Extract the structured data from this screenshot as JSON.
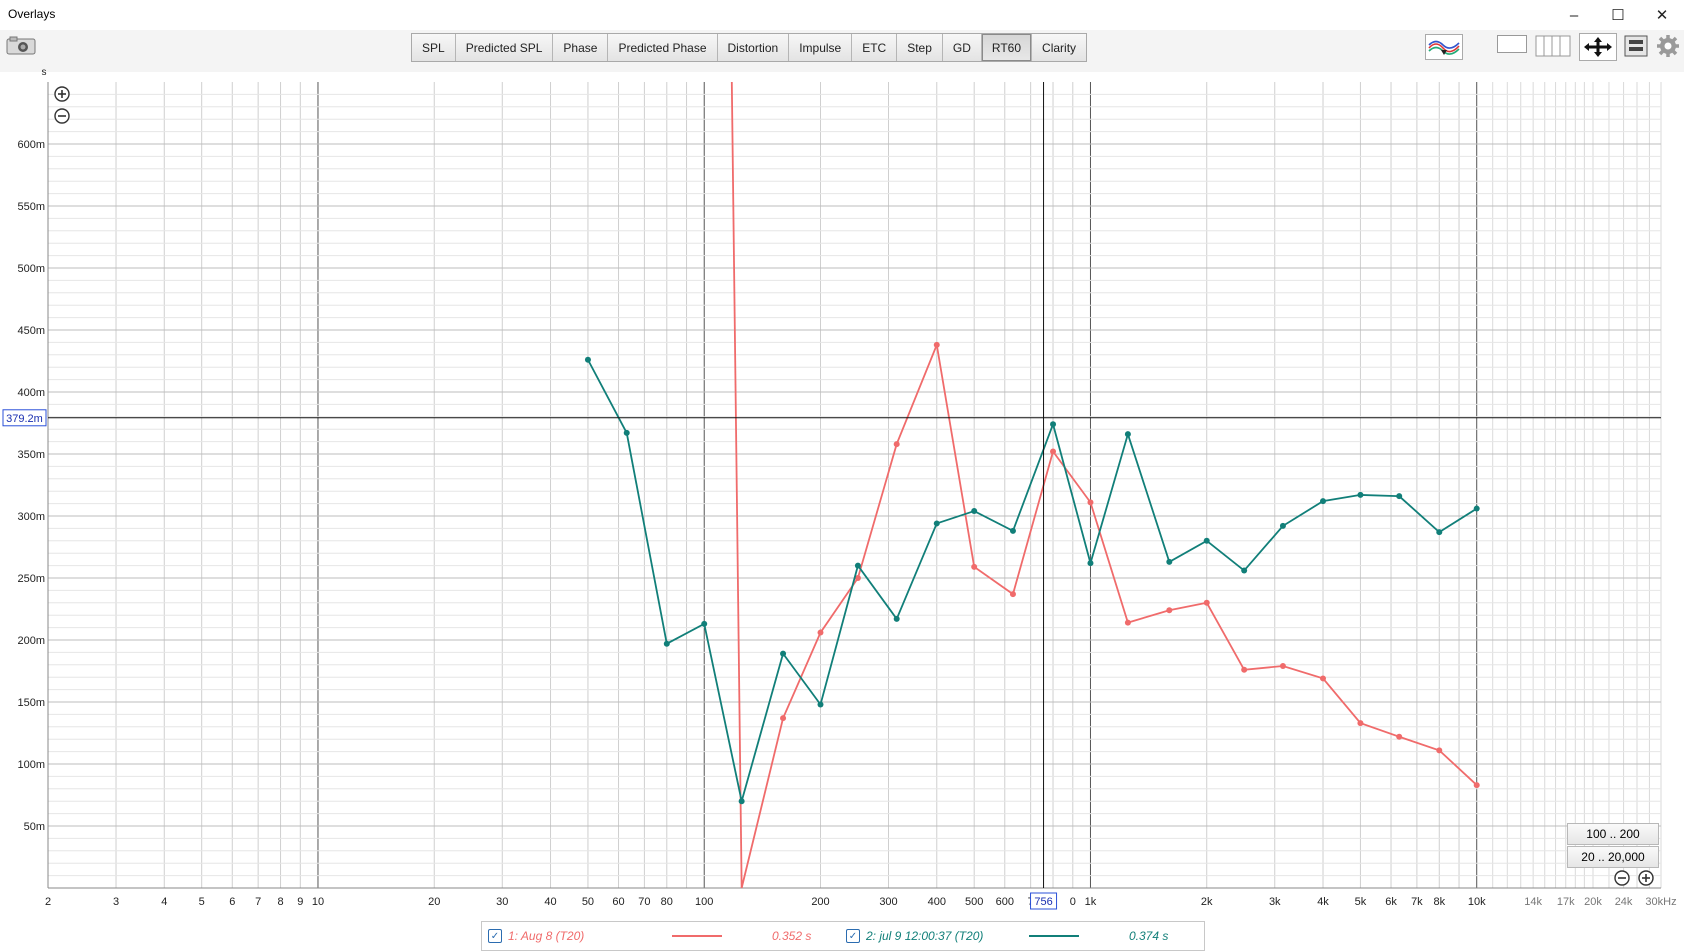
{
  "window": {
    "title": "Overlays",
    "controls": [
      "–",
      "☐",
      "✕"
    ]
  },
  "tabs": [
    {
      "label": "SPL",
      "active": false
    },
    {
      "label": "Predicted SPL",
      "active": false
    },
    {
      "label": "Phase",
      "active": false
    },
    {
      "label": "Predicted Phase",
      "active": false
    },
    {
      "label": "Distortion",
      "active": false
    },
    {
      "label": "Impulse",
      "active": false
    },
    {
      "label": "ETC",
      "active": false
    },
    {
      "label": "Step",
      "active": false
    },
    {
      "label": "GD",
      "active": false
    },
    {
      "label": "RT60",
      "active": true
    },
    {
      "label": "Clarity",
      "active": false
    }
  ],
  "toolbar_icons": [
    "camera-icon",
    "trace-arrangement-icon",
    "single-pane-icon",
    "multi-pane-icon",
    "pan-arrows-icon",
    "controls-icon",
    "settings-gear-icon"
  ],
  "cursor": {
    "x_label": "756",
    "y_label": "379.2m",
    "x_value": 756,
    "y_value": 0.3792
  },
  "range_buttons": {
    "narrow": "100 .. 200",
    "wide": "20 .. 20,000"
  },
  "legend": [
    {
      "label": "1: Aug 8 (T20)",
      "value": "0.352 s",
      "color": "#f06b6b"
    },
    {
      "label": "2: jul 9 12:00:37 (T20)",
      "value": "0.374 s",
      "color": "#117f79"
    }
  ],
  "chart_data": {
    "type": "line",
    "title": "",
    "ylabel": "s",
    "xlabel": "",
    "x_scale": "log",
    "xlim": [
      2,
      30000
    ],
    "ylim": [
      0,
      0.65
    ],
    "grid": true,
    "y_ticks": [
      {
        "v": 0.05,
        "label": "50m"
      },
      {
        "v": 0.1,
        "label": "100m"
      },
      {
        "v": 0.15,
        "label": "150m"
      },
      {
        "v": 0.2,
        "label": "200m"
      },
      {
        "v": 0.25,
        "label": "250m"
      },
      {
        "v": 0.3,
        "label": "300m"
      },
      {
        "v": 0.35,
        "label": "350m"
      },
      {
        "v": 0.4,
        "label": "400m"
      },
      {
        "v": 0.45,
        "label": "450m"
      },
      {
        "v": 0.5,
        "label": "500m"
      },
      {
        "v": 0.55,
        "label": "550m"
      },
      {
        "v": 0.6,
        "label": "600m"
      }
    ],
    "x_ticks": [
      {
        "v": 2,
        "label": "2"
      },
      {
        "v": 3,
        "label": "3"
      },
      {
        "v": 4,
        "label": "4"
      },
      {
        "v": 5,
        "label": "5"
      },
      {
        "v": 6,
        "label": "6"
      },
      {
        "v": 7,
        "label": "7"
      },
      {
        "v": 8,
        "label": "8"
      },
      {
        "v": 9,
        "label": "9"
      },
      {
        "v": 10,
        "label": "10"
      },
      {
        "v": 20,
        "label": "20"
      },
      {
        "v": 30,
        "label": "30"
      },
      {
        "v": 40,
        "label": "40"
      },
      {
        "v": 50,
        "label": "50"
      },
      {
        "v": 60,
        "label": "60"
      },
      {
        "v": 70,
        "label": "70"
      },
      {
        "v": 80,
        "label": "80"
      },
      {
        "v": 100,
        "label": "100"
      },
      {
        "v": 200,
        "label": "200"
      },
      {
        "v": 300,
        "label": "300"
      },
      {
        "v": 400,
        "label": "400"
      },
      {
        "v": 500,
        "label": "500"
      },
      {
        "v": 600,
        "label": "600"
      },
      {
        "v": 700,
        "label": "7"
      },
      {
        "v": 900,
        "label": "0"
      },
      {
        "v": 1000,
        "label": "1k"
      },
      {
        "v": 2000,
        "label": "2k"
      },
      {
        "v": 3000,
        "label": "3k"
      },
      {
        "v": 4000,
        "label": "4k"
      },
      {
        "v": 5000,
        "label": "5k"
      },
      {
        "v": 6000,
        "label": "6k"
      },
      {
        "v": 7000,
        "label": "7k"
      },
      {
        "v": 8000,
        "label": "8k"
      },
      {
        "v": 10000,
        "label": "10k"
      },
      {
        "v": 14000,
        "label": "14k"
      },
      {
        "v": 17000,
        "label": "17k"
      },
      {
        "v": 20000,
        "label": "20k"
      },
      {
        "v": 24000,
        "label": "24k"
      },
      {
        "v": 30000,
        "label": "30kHz"
      }
    ],
    "series": [
      {
        "name": "1: Aug 8 (T20)",
        "color": "#f06b6b",
        "spike": {
          "x": 120,
          "to_y": 0.65
        },
        "points": [
          [
            125,
            0.0
          ],
          [
            160,
            0.137
          ],
          [
            200,
            0.206
          ],
          [
            250,
            0.25
          ],
          [
            315,
            0.358
          ],
          [
            400,
            0.438
          ],
          [
            500,
            0.259
          ],
          [
            630,
            0.237
          ],
          [
            800,
            0.352
          ],
          [
            1000,
            0.311
          ],
          [
            1250,
            0.214
          ],
          [
            1600,
            0.224
          ],
          [
            2000,
            0.23
          ],
          [
            2500,
            0.176
          ],
          [
            3150,
            0.179
          ],
          [
            4000,
            0.169
          ],
          [
            5000,
            0.133
          ],
          [
            6300,
            0.122
          ],
          [
            8000,
            0.111
          ],
          [
            10000,
            0.083
          ]
        ]
      },
      {
        "name": "2: jul 9 12:00:37 (T20)",
        "color": "#117f79",
        "points": [
          [
            50,
            0.426
          ],
          [
            63,
            0.367
          ],
          [
            80,
            0.197
          ],
          [
            100,
            0.213
          ],
          [
            125,
            0.07
          ],
          [
            160,
            0.189
          ],
          [
            200,
            0.148
          ],
          [
            250,
            0.26
          ],
          [
            315,
            0.217
          ],
          [
            400,
            0.294
          ],
          [
            500,
            0.304
          ],
          [
            630,
            0.288
          ],
          [
            800,
            0.374
          ],
          [
            1000,
            0.262
          ],
          [
            1250,
            0.366
          ],
          [
            1600,
            0.263
          ],
          [
            2000,
            0.28
          ],
          [
            2500,
            0.256
          ],
          [
            3150,
            0.292
          ],
          [
            4000,
            0.312
          ],
          [
            5000,
            0.317
          ],
          [
            6300,
            0.316
          ],
          [
            8000,
            0.287
          ],
          [
            10000,
            0.306
          ]
        ]
      }
    ]
  }
}
